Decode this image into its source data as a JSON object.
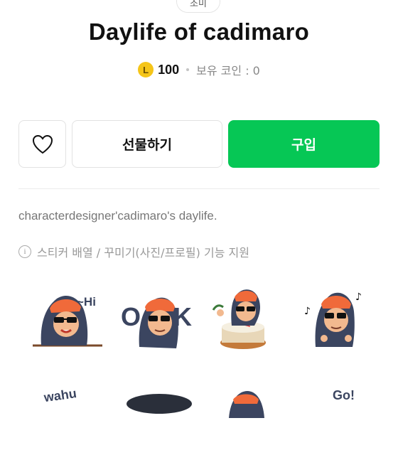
{
  "top_chip": {
    "label": "조미"
  },
  "title": "Daylife of cadimaro",
  "price": {
    "coin_symbol": "L",
    "amount": "100",
    "owned_label": "보유 코인 : 0"
  },
  "buttons": {
    "like_icon": "heart-icon",
    "gift_label": "선물하기",
    "buy_label": "구입"
  },
  "description": "characterdesigner'cadimaro's daylife.",
  "feature_note": "스티커 배열 / 꾸미기(사진/프로필) 기능 지원",
  "stickers": {
    "s1_text": "~Hi",
    "s2_text_left": "O",
    "s2_text_right": "K",
    "s8_text": "Go!",
    "s5_text": "wahu"
  },
  "colors": {
    "buy_green": "#06c755",
    "coin_yellow": "#f5c518",
    "hood_navy": "#3b4560",
    "cap_orange": "#f06a3a"
  }
}
